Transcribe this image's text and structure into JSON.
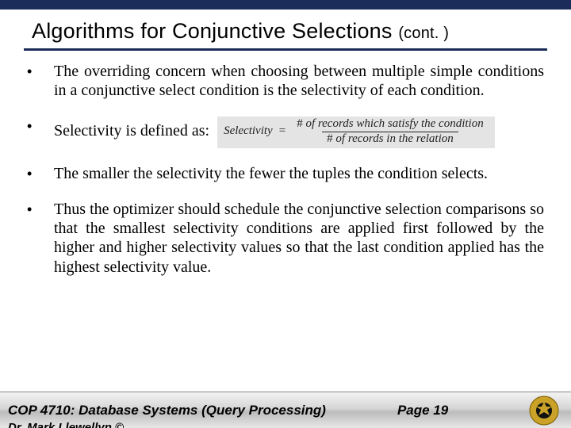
{
  "title": {
    "main": "Algorithms for Conjunctive Selections",
    "cont": "(cont. )"
  },
  "bullets": {
    "b1": "The overriding concern when choosing between multiple simple conditions in a conjunctive select condition is the selectivity of each condition.",
    "b2_lead": "Selectivity is defined as:",
    "formula": {
      "lhs": "Selectivity",
      "eq": "=",
      "num_prefix": "#",
      "num_rest": " of records which satisfy the condition",
      "den_prefix": "#",
      "den_rest": " of records in the relation"
    },
    "b3": "The smaller the selectivity the fewer the tuples the condition selects.",
    "b4": "Thus the optimizer should schedule the conjunctive selection comparisons so that the smallest selectivity conditions are applied first followed by the higher and higher selectivity values so that the last condition applied has the highest selectivity value."
  },
  "footer": {
    "course": "COP 4710: Database Systems (Query Processing)",
    "page": "Page 19",
    "author": "Dr. Mark Llewellyn ©"
  }
}
